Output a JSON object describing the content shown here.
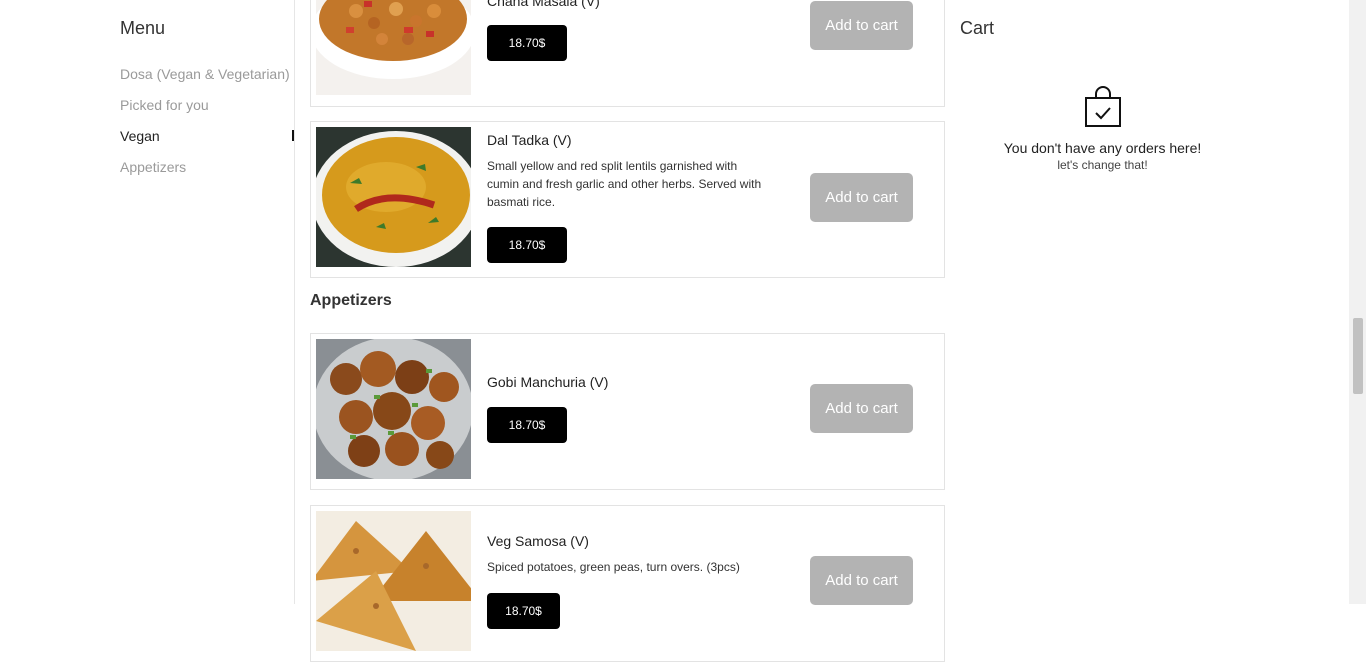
{
  "menu": {
    "title": "Menu",
    "items": [
      {
        "label": "Dosa (Vegan & Vegetarian)"
      },
      {
        "label": "Picked for you"
      },
      {
        "label": "Vegan"
      },
      {
        "label": "Appetizers"
      }
    ],
    "active_item": "Vegan"
  },
  "products": [
    {
      "name": "Chana Masala (V)",
      "description": "",
      "price": "18.70$",
      "add_label": "Add to cart"
    },
    {
      "name": "Dal Tadka (V)",
      "description": "Small yellow and red split lentils garnished with cumin and fresh garlic and other herbs. Served with basmati rice.",
      "price": "18.70$",
      "add_label": "Add to cart"
    },
    {
      "name": "Gobi Manchuria (V)",
      "description": "",
      "price": "18.70$",
      "add_label": "Add to cart"
    },
    {
      "name": "Veg Samosa (V)",
      "description": "Spiced potatoes, green peas, turn overs. (3pcs)",
      "price": "18.70$",
      "add_label": "Add to cart"
    }
  ],
  "sections": {
    "appetizers_title": "Appetizers"
  },
  "cart": {
    "title": "Cart",
    "empty_icon": "shopping-bag-check-icon",
    "empty_message": "You don't have any orders here!",
    "empty_submessage": "let's change that!"
  },
  "colors": {
    "price_button": "#000000",
    "add_button": "#b3b3b3",
    "active_menu": "#222222",
    "inactive_menu": "#9a9a9a"
  }
}
